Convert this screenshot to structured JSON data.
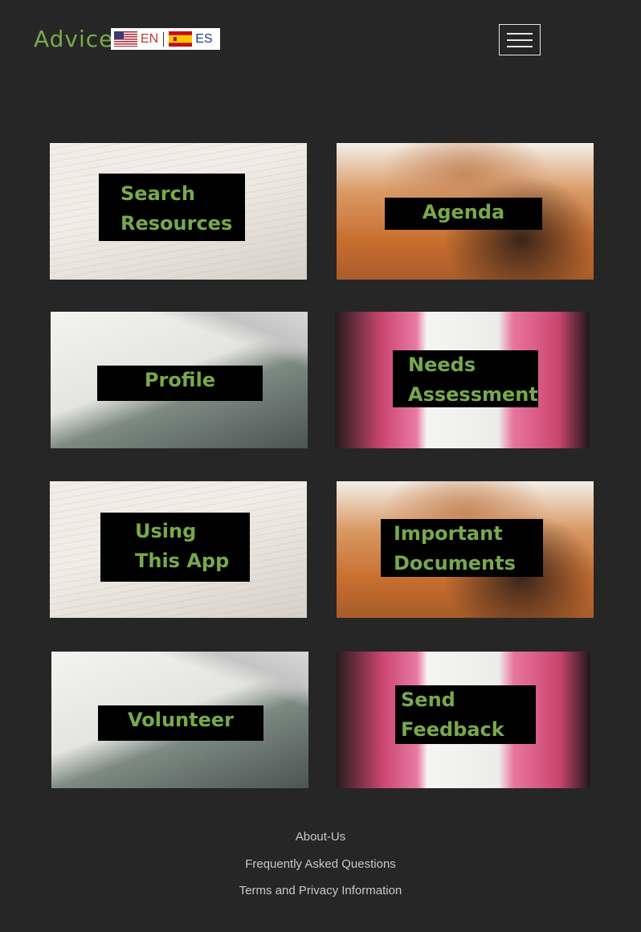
{
  "header": {
    "brand": "Advice",
    "languages": [
      {
        "code": "EN",
        "flag": "us-flag-icon"
      },
      {
        "code": "ES",
        "flag": "spain-flag-icon"
      }
    ],
    "menu_icon": "hamburger-menu-icon"
  },
  "tiles": [
    {
      "line1": "Search",
      "line2": "Resources",
      "image": "pen-and-paper-photo"
    },
    {
      "line1": "Agenda",
      "line2": "",
      "image": "handshake-photo"
    },
    {
      "line1": "Profile",
      "line2": "",
      "image": "glasses-and-laptop-photo"
    },
    {
      "line1": "Needs",
      "line2": "Assessment",
      "image": "notebook-photo"
    },
    {
      "line1": "Using",
      "line2": "This App",
      "image": "pen-and-paper-photo"
    },
    {
      "line1": "Important",
      "line2": "Documents",
      "image": "handshake-photo"
    },
    {
      "line1": "Volunteer",
      "line2": "",
      "image": "glasses-and-laptop-photo"
    },
    {
      "line1": "Send",
      "line2": "Feedback",
      "image": "notebook-photo"
    }
  ],
  "footer": {
    "about": "About-Us",
    "faq": "Frequently Asked Questions",
    "terms": "Terms and Privacy Information"
  },
  "colors": {
    "background": "#262626",
    "accent": "#77a94c",
    "label_bg": "#000000"
  }
}
